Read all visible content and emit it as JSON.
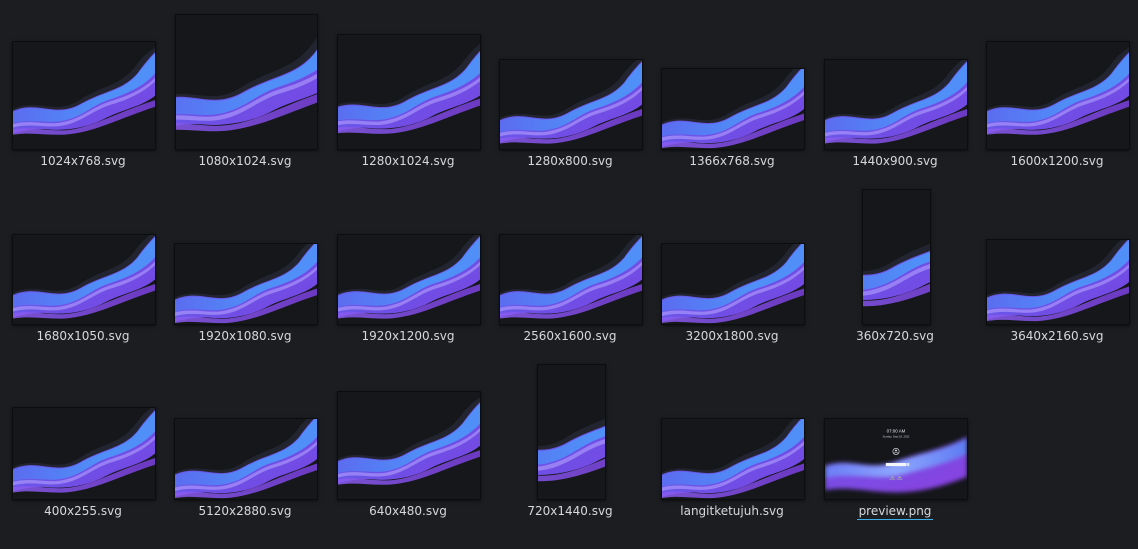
{
  "files": [
    {
      "name": "1024x768.svg",
      "kind": "svg",
      "ratio": 1.3333
    },
    {
      "name": "1080x1024.svg",
      "kind": "svg",
      "ratio": 1.0547
    },
    {
      "name": "1280x1024.svg",
      "kind": "svg",
      "ratio": 1.25
    },
    {
      "name": "1280x800.svg",
      "kind": "svg",
      "ratio": 1.6
    },
    {
      "name": "1366x768.svg",
      "kind": "svg",
      "ratio": 1.7786
    },
    {
      "name": "1440x900.svg",
      "kind": "svg",
      "ratio": 1.6
    },
    {
      "name": "1600x1200.svg",
      "kind": "svg",
      "ratio": 1.3333
    },
    {
      "name": "1680x1050.svg",
      "kind": "svg",
      "ratio": 1.6
    },
    {
      "name": "1920x1080.svg",
      "kind": "svg",
      "ratio": 1.7778
    },
    {
      "name": "1920x1200.svg",
      "kind": "svg",
      "ratio": 1.6
    },
    {
      "name": "2560x1600.svg",
      "kind": "svg",
      "ratio": 1.6
    },
    {
      "name": "3200x1800.svg",
      "kind": "svg",
      "ratio": 1.7778
    },
    {
      "name": "360x720.svg",
      "kind": "svg",
      "ratio": 0.5
    },
    {
      "name": "3640x2160.svg",
      "kind": "svg",
      "ratio": 1.6852
    },
    {
      "name": "400x255.svg",
      "kind": "svg",
      "ratio": 1.5686
    },
    {
      "name": "5120x2880.svg",
      "kind": "svg",
      "ratio": 1.7778
    },
    {
      "name": "640x480.svg",
      "kind": "svg",
      "ratio": 1.3333
    },
    {
      "name": "720x1440.svg",
      "kind": "svg",
      "ratio": 0.5
    },
    {
      "name": "langitketujuh.svg",
      "kind": "svg",
      "ratio": 1.7778
    },
    {
      "name": "preview.png",
      "kind": "png",
      "ratio": 1.7778,
      "current": true,
      "lockscreen": {
        "time": "07:00 AM",
        "date": "Sunday, Sept 18, 2022"
      }
    }
  ],
  "colors": {
    "background": "#1b1d21",
    "thumb_bg": "#15171a",
    "wave_light": "#4f8ff7",
    "wave_mid": "#5b6cf0",
    "wave_deep": "#7b3fe0",
    "accent": "#3daee9"
  }
}
